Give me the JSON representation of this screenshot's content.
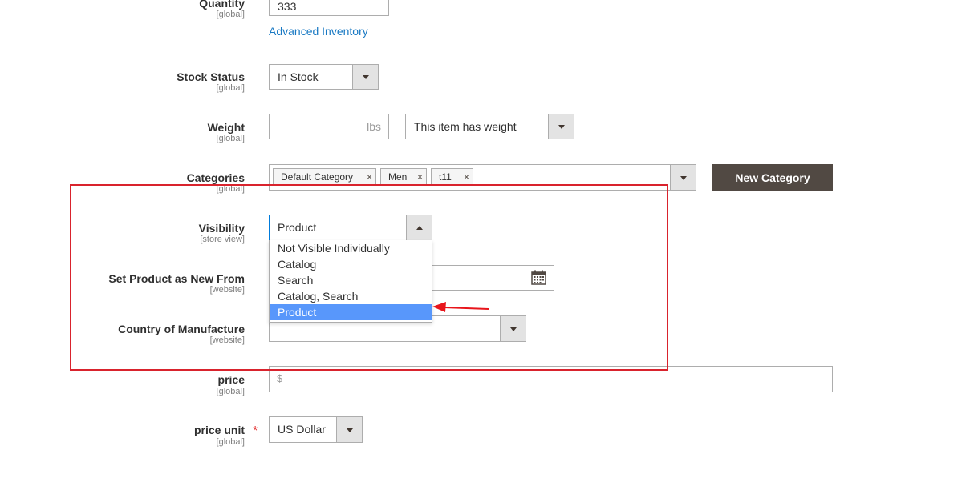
{
  "quantity": {
    "label": "Quantity",
    "scope": "[global]",
    "value": "333",
    "advanced_link": "Advanced Inventory"
  },
  "stock_status": {
    "label": "Stock Status",
    "scope": "[global]",
    "value": "In Stock"
  },
  "weight": {
    "label": "Weight",
    "scope": "[global]",
    "value": "",
    "unit": "lbs",
    "weight_type": "This item has weight"
  },
  "categories": {
    "label": "Categories",
    "scope": "[global]",
    "chips": [
      "Default Category",
      "Men",
      "t11"
    ],
    "new_button": "New Category"
  },
  "visibility": {
    "label": "Visibility",
    "scope": "[store view]",
    "value": "Product",
    "options": [
      "Not Visible Individually",
      "Catalog",
      "Search",
      "Catalog, Search",
      "Product"
    ],
    "selected_index": 4
  },
  "new_from": {
    "label": "Set Product as New From",
    "scope": "[website]",
    "value": ""
  },
  "country": {
    "label": "Country of Manufacture",
    "scope": "[website]",
    "value": ""
  },
  "price": {
    "label": "price",
    "scope": "[global]",
    "currency_symbol": "$",
    "value": ""
  },
  "price_unit": {
    "label": "price unit",
    "scope": "[global]",
    "required_mark": "*",
    "value": "US Dollar"
  },
  "annotation": {
    "box_color": "#d9232d",
    "arrow_color": "#e8151b",
    "highlight_color": "#5897fb"
  }
}
